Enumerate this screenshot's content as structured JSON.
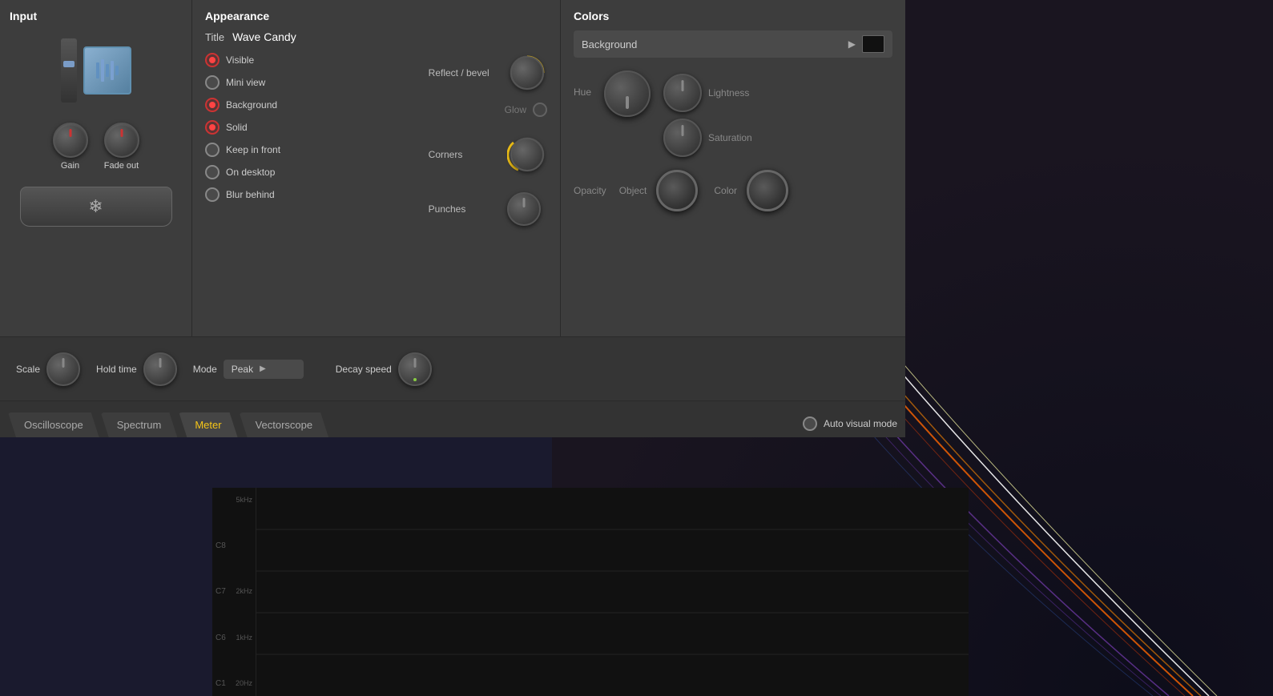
{
  "background_color": "#1a1a2e",
  "input_panel": {
    "title": "Input",
    "gain_label": "Gain",
    "fade_out_label": "Fade out"
  },
  "appearance_panel": {
    "title": "Appearance",
    "title_label": "Title",
    "title_value": "Wave Candy",
    "reflect_bevel_label": "Reflect / bevel",
    "glow_label": "Glow",
    "corners_label": "Corners",
    "punches_label": "Punches",
    "options": [
      {
        "label": "Visible",
        "active": true
      },
      {
        "label": "Mini view",
        "active": false
      },
      {
        "label": "Background",
        "active": true
      },
      {
        "label": "Solid",
        "active": true
      },
      {
        "label": "Keep in front",
        "active": false
      },
      {
        "label": "On desktop",
        "active": false
      },
      {
        "label": "Blur behind",
        "active": false
      }
    ]
  },
  "colors_panel": {
    "title": "Colors",
    "background_label": "Background",
    "hue_label": "Hue",
    "lightness_label": "Lightness",
    "saturation_label": "Saturation",
    "opacity_label": "Opacity",
    "object_label": "Object",
    "color_label": "Color"
  },
  "bottom_bar": {
    "scale_label": "Scale",
    "hold_time_label": "Hold time",
    "mode_label": "Mode",
    "mode_value": "Peak",
    "decay_speed_label": "Decay speed"
  },
  "tabs": [
    {
      "label": "Oscilloscope",
      "active": false
    },
    {
      "label": "Spectrum",
      "active": false
    },
    {
      "label": "Meter",
      "active": true
    },
    {
      "label": "Vectorscope",
      "active": false
    }
  ],
  "auto_visual_label": "Auto visual mode",
  "spectrum_labels": [
    {
      "note": "C1",
      "freq": "20Hz"
    },
    {
      "note": "C6",
      "freq": "1kHz"
    },
    {
      "note": "C7",
      "freq": "2kHz"
    },
    {
      "note": "C8",
      "freq": ""
    },
    {
      "note": "",
      "freq": "5kHz"
    }
  ]
}
